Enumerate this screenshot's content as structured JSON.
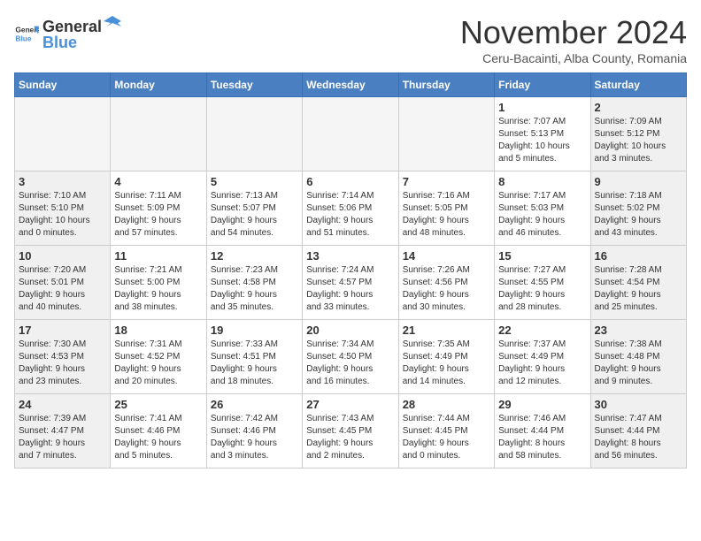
{
  "logo": {
    "general": "General",
    "blue": "Blue"
  },
  "title": "November 2024",
  "location": "Ceru-Bacainti, Alba County, Romania",
  "days_of_week": [
    "Sunday",
    "Monday",
    "Tuesday",
    "Wednesday",
    "Thursday",
    "Friday",
    "Saturday"
  ],
  "weeks": [
    [
      {
        "day": "",
        "info": ""
      },
      {
        "day": "",
        "info": ""
      },
      {
        "day": "",
        "info": ""
      },
      {
        "day": "",
        "info": ""
      },
      {
        "day": "",
        "info": ""
      },
      {
        "day": "1",
        "info": "Sunrise: 7:07 AM\nSunset: 5:13 PM\nDaylight: 10 hours\nand 5 minutes."
      },
      {
        "day": "2",
        "info": "Sunrise: 7:09 AM\nSunset: 5:12 PM\nDaylight: 10 hours\nand 3 minutes."
      }
    ],
    [
      {
        "day": "3",
        "info": "Sunrise: 7:10 AM\nSunset: 5:10 PM\nDaylight: 10 hours\nand 0 minutes."
      },
      {
        "day": "4",
        "info": "Sunrise: 7:11 AM\nSunset: 5:09 PM\nDaylight: 9 hours\nand 57 minutes."
      },
      {
        "day": "5",
        "info": "Sunrise: 7:13 AM\nSunset: 5:07 PM\nDaylight: 9 hours\nand 54 minutes."
      },
      {
        "day": "6",
        "info": "Sunrise: 7:14 AM\nSunset: 5:06 PM\nDaylight: 9 hours\nand 51 minutes."
      },
      {
        "day": "7",
        "info": "Sunrise: 7:16 AM\nSunset: 5:05 PM\nDaylight: 9 hours\nand 48 minutes."
      },
      {
        "day": "8",
        "info": "Sunrise: 7:17 AM\nSunset: 5:03 PM\nDaylight: 9 hours\nand 46 minutes."
      },
      {
        "day": "9",
        "info": "Sunrise: 7:18 AM\nSunset: 5:02 PM\nDaylight: 9 hours\nand 43 minutes."
      }
    ],
    [
      {
        "day": "10",
        "info": "Sunrise: 7:20 AM\nSunset: 5:01 PM\nDaylight: 9 hours\nand 40 minutes."
      },
      {
        "day": "11",
        "info": "Sunrise: 7:21 AM\nSunset: 5:00 PM\nDaylight: 9 hours\nand 38 minutes."
      },
      {
        "day": "12",
        "info": "Sunrise: 7:23 AM\nSunset: 4:58 PM\nDaylight: 9 hours\nand 35 minutes."
      },
      {
        "day": "13",
        "info": "Sunrise: 7:24 AM\nSunset: 4:57 PM\nDaylight: 9 hours\nand 33 minutes."
      },
      {
        "day": "14",
        "info": "Sunrise: 7:26 AM\nSunset: 4:56 PM\nDaylight: 9 hours\nand 30 minutes."
      },
      {
        "day": "15",
        "info": "Sunrise: 7:27 AM\nSunset: 4:55 PM\nDaylight: 9 hours\nand 28 minutes."
      },
      {
        "day": "16",
        "info": "Sunrise: 7:28 AM\nSunset: 4:54 PM\nDaylight: 9 hours\nand 25 minutes."
      }
    ],
    [
      {
        "day": "17",
        "info": "Sunrise: 7:30 AM\nSunset: 4:53 PM\nDaylight: 9 hours\nand 23 minutes."
      },
      {
        "day": "18",
        "info": "Sunrise: 7:31 AM\nSunset: 4:52 PM\nDaylight: 9 hours\nand 20 minutes."
      },
      {
        "day": "19",
        "info": "Sunrise: 7:33 AM\nSunset: 4:51 PM\nDaylight: 9 hours\nand 18 minutes."
      },
      {
        "day": "20",
        "info": "Sunrise: 7:34 AM\nSunset: 4:50 PM\nDaylight: 9 hours\nand 16 minutes."
      },
      {
        "day": "21",
        "info": "Sunrise: 7:35 AM\nSunset: 4:49 PM\nDaylight: 9 hours\nand 14 minutes."
      },
      {
        "day": "22",
        "info": "Sunrise: 7:37 AM\nSunset: 4:49 PM\nDaylight: 9 hours\nand 12 minutes."
      },
      {
        "day": "23",
        "info": "Sunrise: 7:38 AM\nSunset: 4:48 PM\nDaylight: 9 hours\nand 9 minutes."
      }
    ],
    [
      {
        "day": "24",
        "info": "Sunrise: 7:39 AM\nSunset: 4:47 PM\nDaylight: 9 hours\nand 7 minutes."
      },
      {
        "day": "25",
        "info": "Sunrise: 7:41 AM\nSunset: 4:46 PM\nDaylight: 9 hours\nand 5 minutes."
      },
      {
        "day": "26",
        "info": "Sunrise: 7:42 AM\nSunset: 4:46 PM\nDaylight: 9 hours\nand 3 minutes."
      },
      {
        "day": "27",
        "info": "Sunrise: 7:43 AM\nSunset: 4:45 PM\nDaylight: 9 hours\nand 2 minutes."
      },
      {
        "day": "28",
        "info": "Sunrise: 7:44 AM\nSunset: 4:45 PM\nDaylight: 9 hours\nand 0 minutes."
      },
      {
        "day": "29",
        "info": "Sunrise: 7:46 AM\nSunset: 4:44 PM\nDaylight: 8 hours\nand 58 minutes."
      },
      {
        "day": "30",
        "info": "Sunrise: 7:47 AM\nSunset: 4:44 PM\nDaylight: 8 hours\nand 56 minutes."
      }
    ]
  ]
}
